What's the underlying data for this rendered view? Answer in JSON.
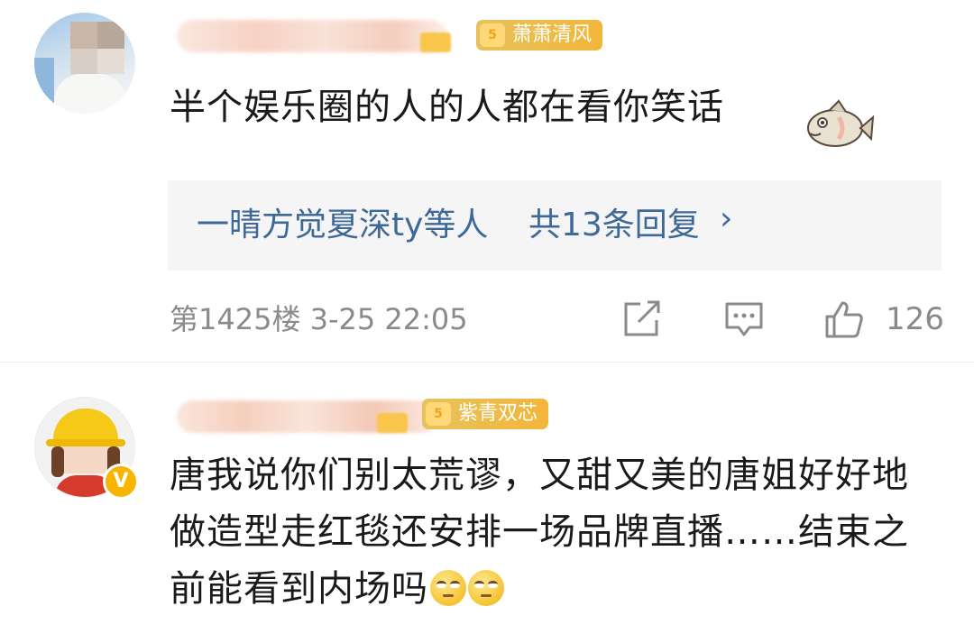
{
  "comments": [
    {
      "badge_title": "萧萧清风",
      "badge_level": "5",
      "content": "半个娱乐圈的人的人都在看你笑话",
      "sticker": "fish-sticker",
      "replies": {
        "names": "一晴方觉夏深ty等人",
        "count_label": "共13条回复",
        "chevron": "›"
      },
      "floor": "第1425楼",
      "time": "3-25 22:05",
      "likes": "126"
    },
    {
      "badge_title": "紫青双芯",
      "badge_level": "5",
      "verified_label": "V",
      "content": "唐我说你们别太荒谬，又甜又美的唐姐好好地做造型走红毯还安排一场品牌直播……结束之前能看到内场吗",
      "emojis": [
        "eye-roll-emoji",
        "eye-roll-emoji"
      ]
    }
  ],
  "icons": {
    "share": "share-icon",
    "comment": "comment-icon",
    "like": "thumbs-up-icon"
  },
  "colors": {
    "link": "#3d6898",
    "meta": "#8a8a8a",
    "badge": "#f3b63a",
    "reply_bg": "#f5f5f5"
  }
}
